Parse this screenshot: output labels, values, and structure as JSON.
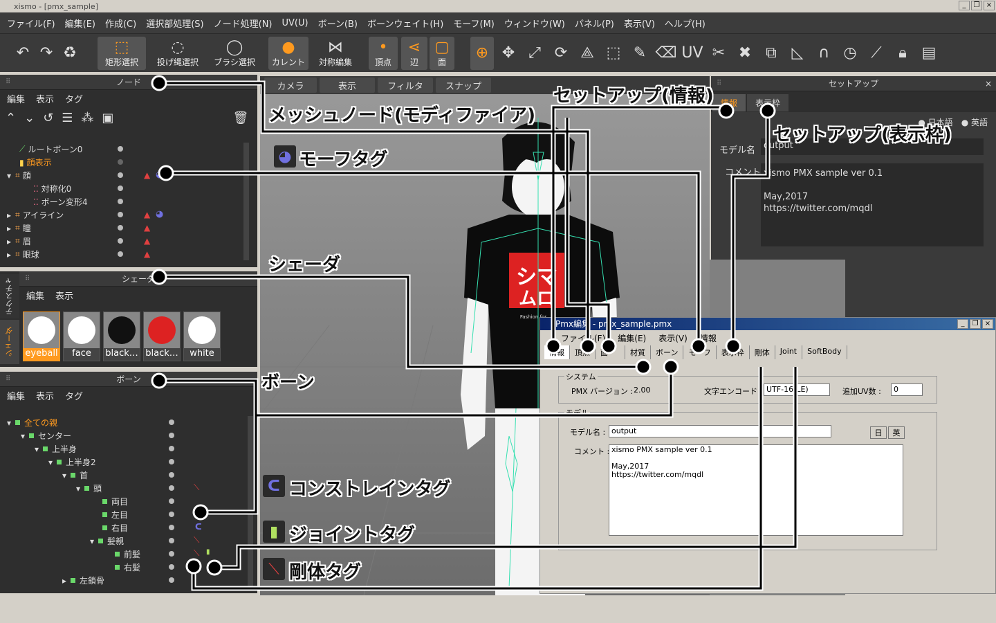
{
  "window": {
    "title": "xismo - [pmx_sample]"
  },
  "menu": [
    "ファイル(F)",
    "編集(E)",
    "作成(C)",
    "選択部処理(S)",
    "ノード処理(N)",
    "UV(U)",
    "ボーン(B)",
    "ボーンウェイト(H)",
    "モーフ(M)",
    "ウィンドウ(W)",
    "パネル(P)",
    "表示(V)",
    "ヘルプ(H)"
  ],
  "toolbar": {
    "rect_select": "矩形選択",
    "lasso_select": "投げ縄選択",
    "brush_select": "ブラシ選択",
    "current": "カレント",
    "symmetry_edit": "対称編集",
    "vertex": "頂点",
    "edge": "辺",
    "face": "面"
  },
  "node_panel": {
    "title": "ノード",
    "menu": [
      "編集",
      "表示",
      "タグ"
    ],
    "rows": [
      {
        "label": "ルートボーン0"
      },
      {
        "label": "顔表示"
      },
      {
        "label": "顔"
      },
      {
        "label": "対称化0"
      },
      {
        "label": "ボーン変形4"
      },
      {
        "label": "アイライン"
      },
      {
        "label": "瞳"
      },
      {
        "label": "眉"
      },
      {
        "label": "眼球"
      }
    ]
  },
  "shader_panel": {
    "title": "シェーダ",
    "menu": [
      "編集",
      "表示"
    ],
    "side_tabs": [
      "テクスチャ",
      "シェーダ"
    ],
    "tiles": [
      "eyeball",
      "face",
      "black…",
      "black…",
      "white"
    ]
  },
  "bone_panel": {
    "title": "ボーン",
    "menu": [
      "編集",
      "表示",
      "タグ"
    ],
    "rows": [
      {
        "label": "全ての親"
      },
      {
        "label": "センター"
      },
      {
        "label": "上半身"
      },
      {
        "label": "上半身2"
      },
      {
        "label": "首"
      },
      {
        "label": "頭"
      },
      {
        "label": "両目"
      },
      {
        "label": "左目"
      },
      {
        "label": "右目"
      },
      {
        "label": "髪親"
      },
      {
        "label": "前髪"
      },
      {
        "label": "右髪"
      },
      {
        "label": "左鎖骨"
      }
    ]
  },
  "viewport_tabs": [
    "カメラ",
    "表示",
    "フィルタ",
    "スナップ"
  ],
  "logo_text": "Fashion for",
  "setup_panel": {
    "title": "セットアップ",
    "tabs": [
      "情報",
      "表示枠"
    ],
    "lang_jp": "日本語",
    "lang_en": "英語",
    "model_name_label": "モデル名",
    "model_name": "output",
    "comment_label": "コメント",
    "comment_line1": "xismo PMX sample ver 0.1",
    "comment_line2": "May,2017",
    "comment_line3": "https://twitter.com/mqdl"
  },
  "pmx_window": {
    "title": "Pmx編集 - pmx_sample.pmx",
    "menu": [
      "ファイル(F)",
      "編集(E)",
      "表示(V)",
      "情報"
    ],
    "tabs": [
      "情報",
      "頂点",
      "面",
      "材質",
      "ボーン",
      "モーフ",
      "表示枠",
      "剛体",
      "Joint",
      "SoftBody"
    ],
    "system_group": "システム",
    "pmx_version_label": "PMX バージョン :",
    "pmx_version": "2.00",
    "encoding_label": "文字エンコード :",
    "encoding": "UTF-16(LE)",
    "uv_label": "追加UV数 :",
    "uv_count": "0",
    "model_group": "モデル",
    "model_name_label": "モデル名 :",
    "model_name": "output",
    "btn_jp": "日",
    "btn_en": "英",
    "comment_label": "コメント :",
    "comment_line1": "xismo PMX sample ver 0.1",
    "comment_line2": "May,2017",
    "comment_line3": "https://twitter.com/mqdl"
  },
  "annotations": {
    "mesh_node": "メッシュノード(モディファイア)",
    "morph_tag": "モーフタグ",
    "shader": "シェーダ",
    "bone": "ボーン",
    "constraint_tag": "コンストレインタグ",
    "joint_tag": "ジョイントタグ",
    "rigid_tag": "剛体タグ",
    "setup_info": "セットアップ(情報)",
    "setup_frame": "セットアップ(表示枠)"
  },
  "colors": {
    "accent": "#ff9a1f",
    "panel_bg": "#2e2e2e",
    "viewport_bg": "#8a8a8a",
    "tag_red": "#e04040",
    "tag_blue": "#7070e0"
  }
}
